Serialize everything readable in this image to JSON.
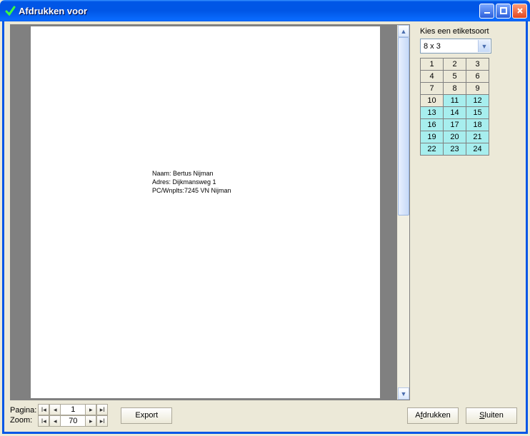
{
  "window": {
    "title": "Afdrukken voor"
  },
  "preview": {
    "line1": "Naam: Bertus Nijman",
    "line2": "Adres: Dijkmansweg 1",
    "line3": "PC/Wnplts:7245 VN  Nijman"
  },
  "sidebar": {
    "label": "Kies een etiketsoort",
    "dropdown_value": "8 x 3",
    "cells": [
      {
        "n": "1",
        "on": false
      },
      {
        "n": "2",
        "on": false
      },
      {
        "n": "3",
        "on": false
      },
      {
        "n": "4",
        "on": false
      },
      {
        "n": "5",
        "on": false
      },
      {
        "n": "6",
        "on": false
      },
      {
        "n": "7",
        "on": false
      },
      {
        "n": "8",
        "on": false
      },
      {
        "n": "9",
        "on": false
      },
      {
        "n": "10",
        "on": false
      },
      {
        "n": "11",
        "on": true
      },
      {
        "n": "12",
        "on": true
      },
      {
        "n": "13",
        "on": true
      },
      {
        "n": "14",
        "on": true
      },
      {
        "n": "15",
        "on": true
      },
      {
        "n": "16",
        "on": true
      },
      {
        "n": "17",
        "on": true
      },
      {
        "n": "18",
        "on": true
      },
      {
        "n": "19",
        "on": true
      },
      {
        "n": "20",
        "on": true
      },
      {
        "n": "21",
        "on": true
      },
      {
        "n": "22",
        "on": true
      },
      {
        "n": "23",
        "on": true
      },
      {
        "n": "24",
        "on": true
      }
    ]
  },
  "footer": {
    "page_label": "Pagina:",
    "zoom_label": "Zoom:",
    "page_value": "1",
    "zoom_value": "70",
    "export_label": "Export",
    "print_label_pre": "A",
    "print_label_u": "f",
    "print_label_post": "drukken",
    "close_label_pre": "",
    "close_label_u": "S",
    "close_label_post": "luiten"
  }
}
